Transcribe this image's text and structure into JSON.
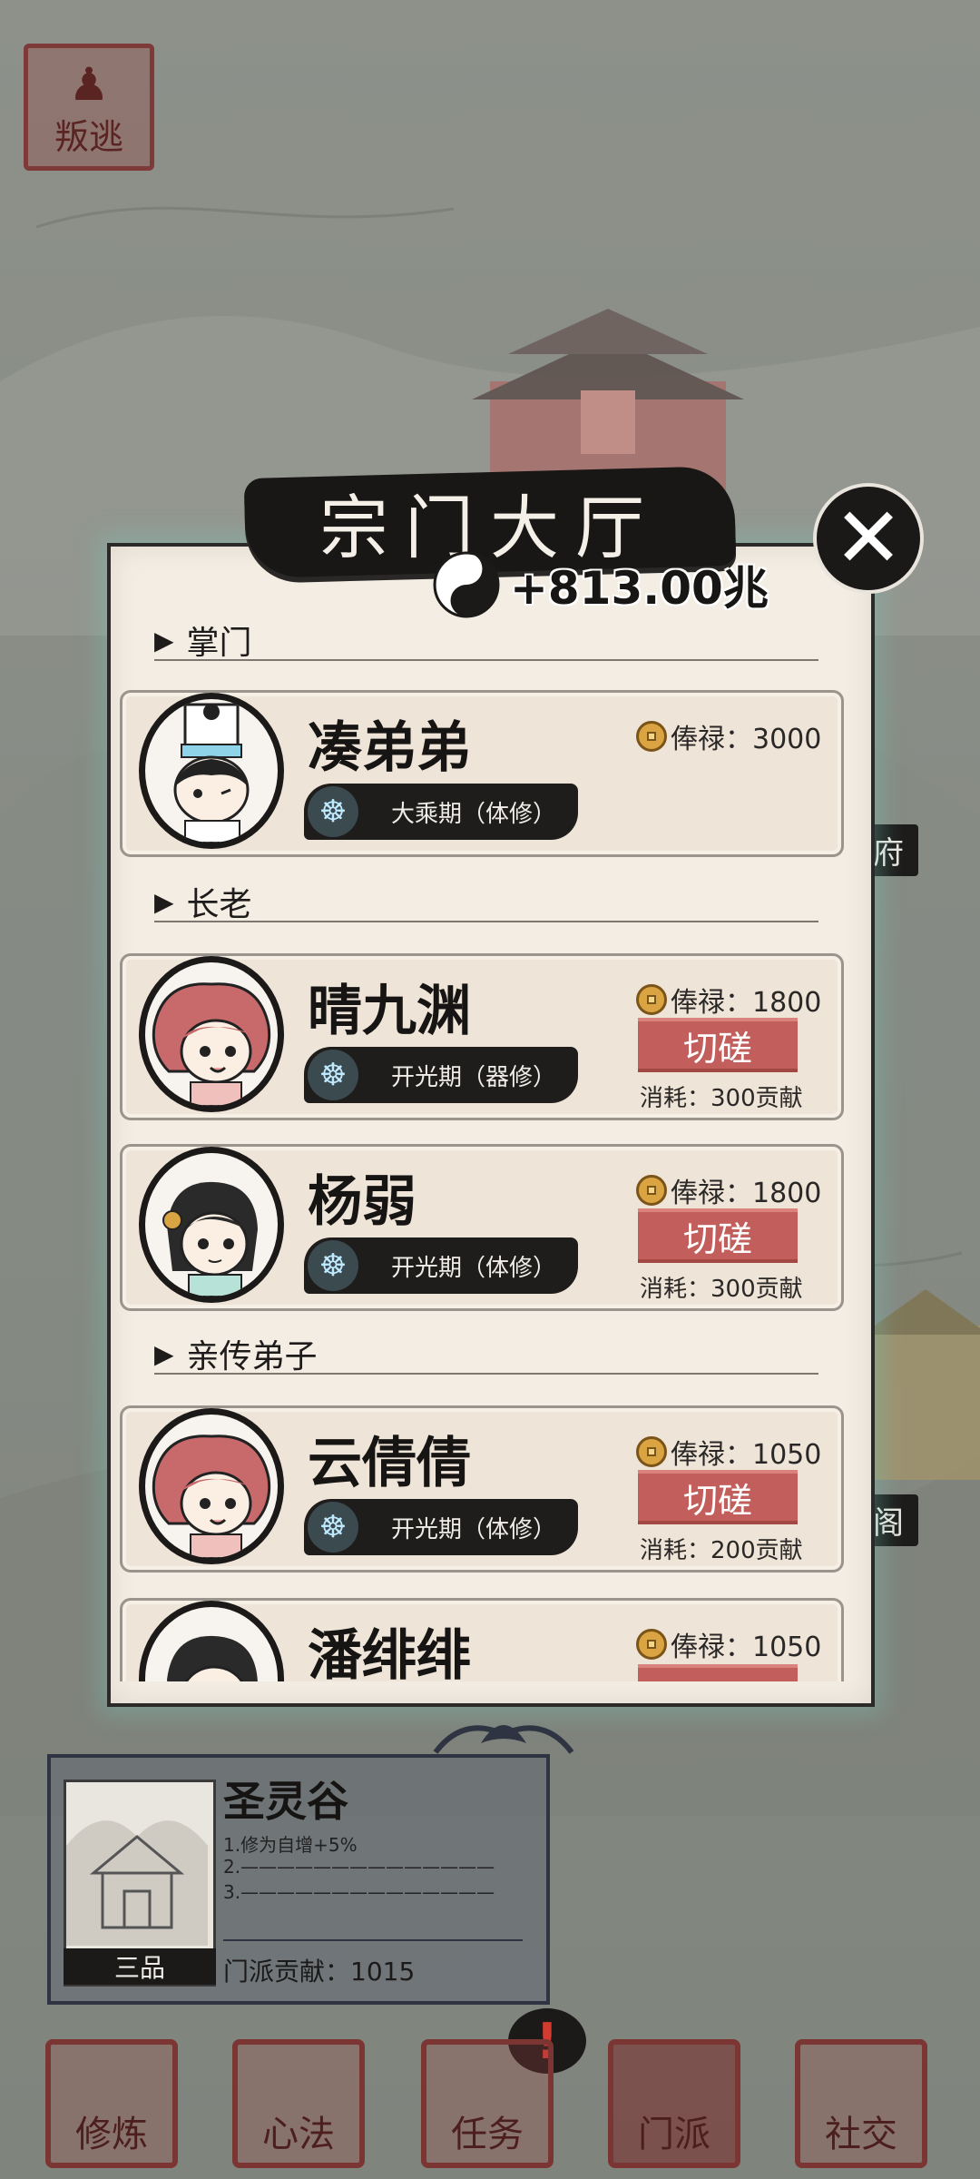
{
  "top_left": {
    "escape_label": "叛逃"
  },
  "modal": {
    "title": "宗门大厅",
    "currency_value": "+813.00兆",
    "close_icon": "close-x-icon"
  },
  "sections": [
    {
      "title": "掌门"
    },
    {
      "title": "长老"
    },
    {
      "title": "亲传弟子"
    }
  ],
  "members": [
    {
      "name": "凑弟弟",
      "realm": "大乘期（体修）",
      "salary": "俸禄：3000",
      "spar": "",
      "cost": ""
    },
    {
      "name": "晴九渊",
      "realm": "开光期（器修）",
      "salary": "俸禄：1800",
      "spar": "切磋",
      "cost": "消耗：300贡献"
    },
    {
      "name": "杨弱",
      "realm": "开光期（体修）",
      "salary": "俸禄：1800",
      "spar": "切磋",
      "cost": "消耗：300贡献"
    },
    {
      "name": "云倩倩",
      "realm": "开光期（体修）",
      "salary": "俸禄：1050",
      "spar": "切磋",
      "cost": "消耗：200贡献"
    },
    {
      "name": "潘绯绯",
      "realm": "",
      "salary": "俸禄：1050",
      "spar": "",
      "cost": ""
    }
  ],
  "map_labels": {
    "right_upper": "府",
    "right_lower": "阁"
  },
  "sect_panel": {
    "name": "圣灵谷",
    "line1": "1.修为自增+5%",
    "line2": "2.——————————————",
    "line3": "3.——————————————",
    "grade": "三品",
    "contribution": "门派贡献：1015"
  },
  "alert": "!",
  "nav": [
    {
      "label": "修炼"
    },
    {
      "label": "心法"
    },
    {
      "label": "任务"
    },
    {
      "label": "门派"
    },
    {
      "label": "社交"
    }
  ]
}
